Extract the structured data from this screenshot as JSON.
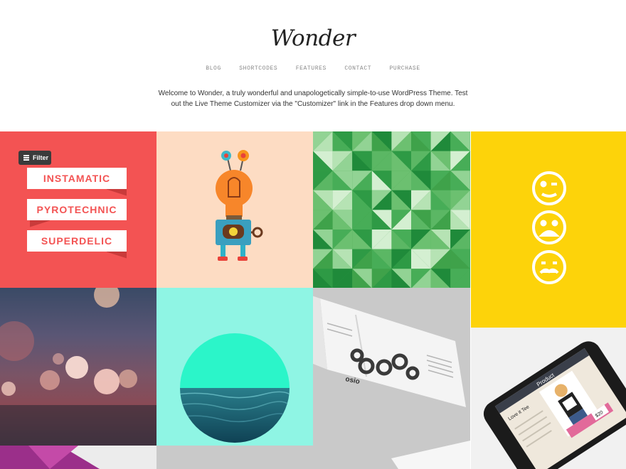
{
  "header": {
    "logo": "Wonder",
    "nav": [
      "BLOG",
      "SHORTCODES",
      "FEATURES",
      "CONTACT",
      "PURCHASE"
    ],
    "intro_line1": "Welcome to Wonder, a truly wonderful and unapologetically simple-to-use WordPress Theme. Test",
    "intro_line2": "out the Live Theme Customizer via the \"Customizer\" link in the Features drop down menu."
  },
  "filter": {
    "label": "Filter"
  },
  "portfolio": {
    "ribbons": [
      "INSTAMATIC",
      "PYROTECHNIC",
      "SUPERDELIC"
    ],
    "brochure": {
      "brand": "osio"
    },
    "phone": {
      "product": "Product",
      "item_title": "Love it Tee",
      "price": "$20"
    }
  },
  "colors": {
    "red_tile": "#f35353",
    "peach_tile": "#fddcc3",
    "green": "#3fa24a",
    "yellow_tile": "#fdd30a",
    "aqua_tile": "#8ff5e4",
    "grey_tile": "#c9c9c9"
  },
  "icons": [
    "menu-icon",
    "wink-face-icon",
    "sad-face-icon",
    "mustache-face-icon",
    "lightbulb-robot-icon"
  ]
}
